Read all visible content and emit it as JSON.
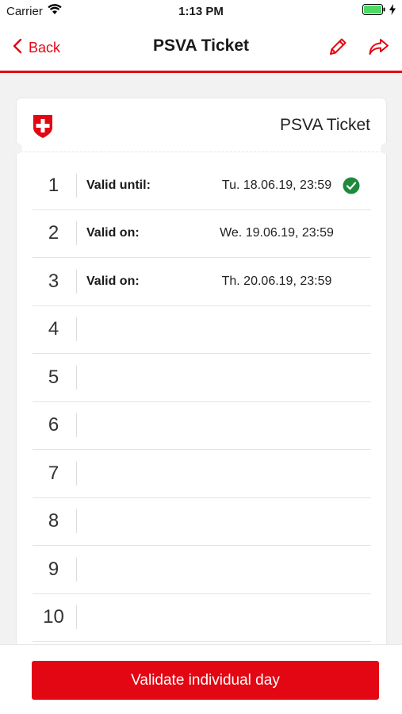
{
  "status_bar": {
    "carrier": "Carrier",
    "time": "1:13 PM",
    "battery_color": "#4cd964"
  },
  "nav": {
    "back_label": "Back",
    "title": "PSVA Ticket",
    "edit_icon": "pencil-icon",
    "share_icon": "share-arrow-icon"
  },
  "ticket": {
    "name": "PSVA Ticket",
    "rows": [
      {
        "number": "1",
        "label": "Valid until:",
        "date": "Tu. 18.06.19, 23:59",
        "validated": true
      },
      {
        "number": "2",
        "label": "Valid on:",
        "date": "We. 19.06.19, 23:59",
        "validated": false
      },
      {
        "number": "3",
        "label": "Valid on:",
        "date": "Th. 20.06.19, 23:59",
        "validated": false
      },
      {
        "number": "4",
        "label": "",
        "date": "",
        "validated": false
      },
      {
        "number": "5",
        "label": "",
        "date": "",
        "validated": false
      },
      {
        "number": "6",
        "label": "",
        "date": "",
        "validated": false
      },
      {
        "number": "7",
        "label": "",
        "date": "",
        "validated": false
      },
      {
        "number": "8",
        "label": "",
        "date": "",
        "validated": false
      },
      {
        "number": "9",
        "label": "",
        "date": "",
        "validated": false
      },
      {
        "number": "10",
        "label": "",
        "date": "",
        "validated": false
      }
    ]
  },
  "colors": {
    "accent": "#e30613",
    "check": "#1f8a3c"
  },
  "actions": {
    "validate_label": "Validate individual day"
  }
}
